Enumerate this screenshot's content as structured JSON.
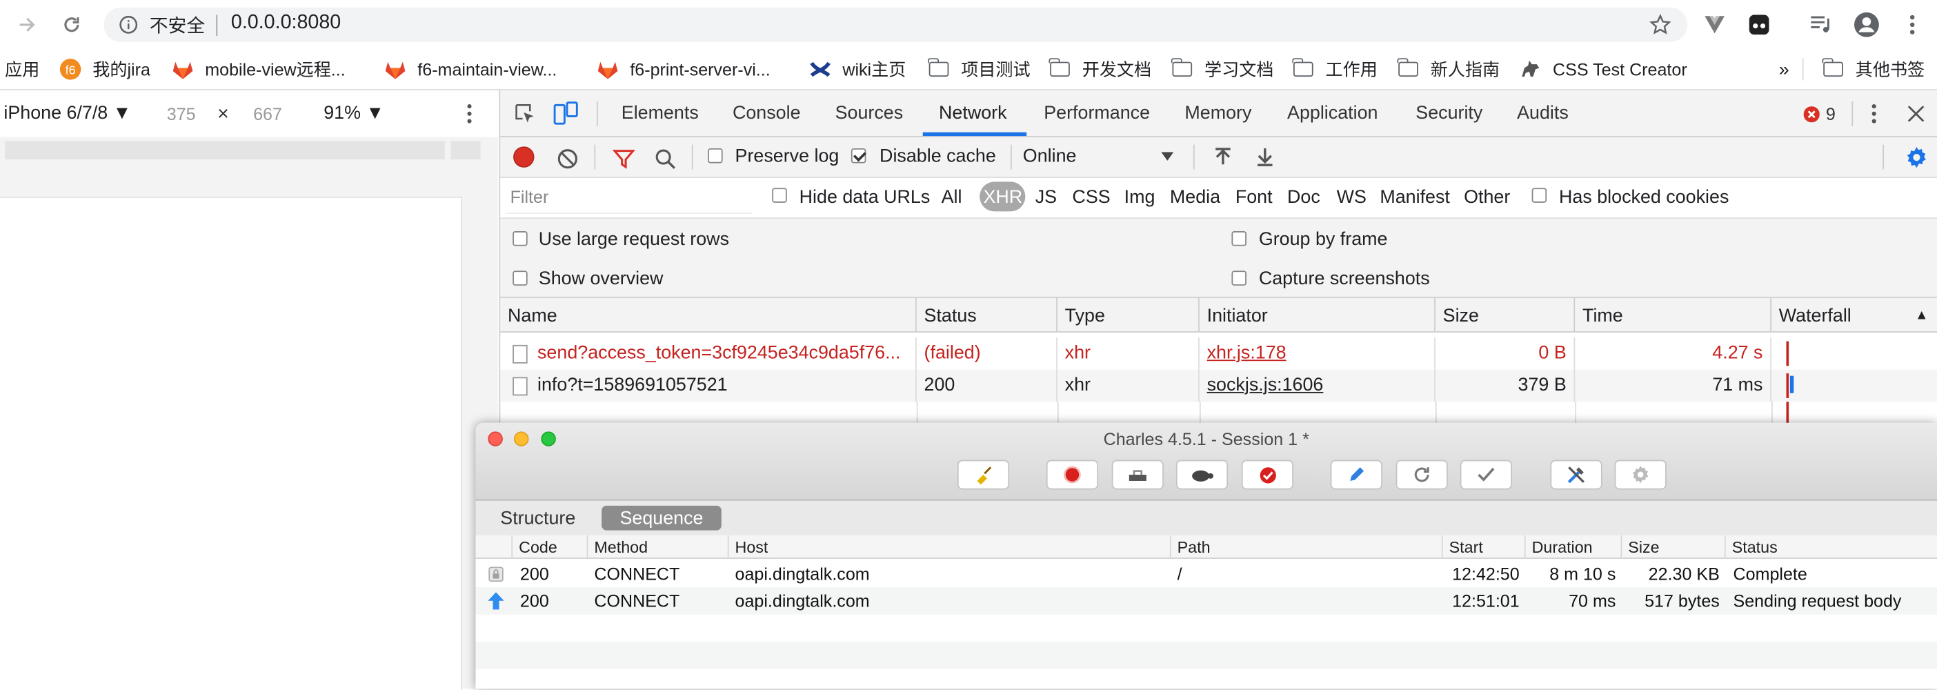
{
  "browser": {
    "security_label": "不安全",
    "url": "0.0.0.0:8080",
    "bookmarks": [
      {
        "label": "应用",
        "icon": "apps-icon"
      },
      {
        "label": "我的jira",
        "icon": "jira-icon"
      },
      {
        "label": "mobile-view远程...",
        "icon": "gitlab-icon"
      },
      {
        "label": "f6-maintain-view...",
        "icon": "gitlab-icon"
      },
      {
        "label": "f6-print-server-vi...",
        "icon": "gitlab-icon"
      },
      {
        "label": "wiki主页",
        "icon": "confluence-icon"
      },
      {
        "label": "项目测试",
        "icon": "folder-icon"
      },
      {
        "label": "开发文档",
        "icon": "folder-icon"
      },
      {
        "label": "学习文档",
        "icon": "folder-icon"
      },
      {
        "label": "工作用",
        "icon": "folder-icon"
      },
      {
        "label": "新人指南",
        "icon": "folder-icon"
      },
      {
        "label": "CSS Test Creator",
        "icon": "dog-icon"
      }
    ],
    "more_bookmarks": "»",
    "other_bookmarks": "其他书签"
  },
  "device_toolbar": {
    "device": "iPhone 6/7/8 ▼",
    "width": "375",
    "times": "×",
    "height": "667",
    "zoom": "91% ▼"
  },
  "devtools": {
    "tabs": [
      "Elements",
      "Console",
      "Sources",
      "Network",
      "Performance",
      "Memory",
      "Application",
      "Security",
      "Audits"
    ],
    "active_tab": "Network",
    "error_count": "9",
    "toolbar": {
      "preserve_log": "Preserve log",
      "disable_cache": "Disable cache",
      "throttle": "Online"
    },
    "filter": {
      "placeholder": "Filter",
      "hide_data_urls": "Hide data URLs",
      "types": [
        "All",
        "XHR",
        "JS",
        "CSS",
        "Img",
        "Media",
        "Font",
        "Doc",
        "WS",
        "Manifest",
        "Other"
      ],
      "active_type": "XHR",
      "blocked_cookies": "Has blocked cookies"
    },
    "settings": {
      "large_rows": "Use large request rows",
      "group_by_frame": "Group by frame",
      "show_overview": "Show overview",
      "capture_screenshots": "Capture screenshots"
    },
    "table": {
      "columns": [
        "Name",
        "Status",
        "Type",
        "Initiator",
        "Size",
        "Time",
        "Waterfall"
      ],
      "rows": [
        {
          "name": "send?access_token=3cf9245e34c9da5f76...",
          "status": "(failed)",
          "type": "xhr",
          "initiator": "xhr.js:178",
          "size": "0 B",
          "time": "4.27 s",
          "failed": true
        },
        {
          "name": "info?t=1589691057521",
          "status": "200",
          "type": "xhr",
          "initiator": "sockjs.js:1606",
          "size": "379 B",
          "time": "71 ms",
          "failed": false
        }
      ]
    }
  },
  "charles": {
    "title": "Charles 4.5.1 - Session 1 *",
    "tabs": [
      "Structure",
      "Sequence"
    ],
    "active_tab": "Sequence",
    "columns": [
      "Code",
      "Method",
      "Host",
      "Path",
      "Start",
      "Duration",
      "Size",
      "Status"
    ],
    "rows": [
      {
        "code": "200",
        "method": "CONNECT",
        "host": "oapi.dingtalk.com",
        "path": "/",
        "start": "12:42:50",
        "duration": "8 m 10 s",
        "size": "22.30 KB",
        "status": "Complete",
        "icon": "lock-icon"
      },
      {
        "code": "200",
        "method": "CONNECT",
        "host": "oapi.dingtalk.com",
        "path": "",
        "start": "12:51:01",
        "duration": "70 ms",
        "size": "517 bytes",
        "status": "Sending request body",
        "icon": "upload-arrow-icon"
      }
    ]
  }
}
